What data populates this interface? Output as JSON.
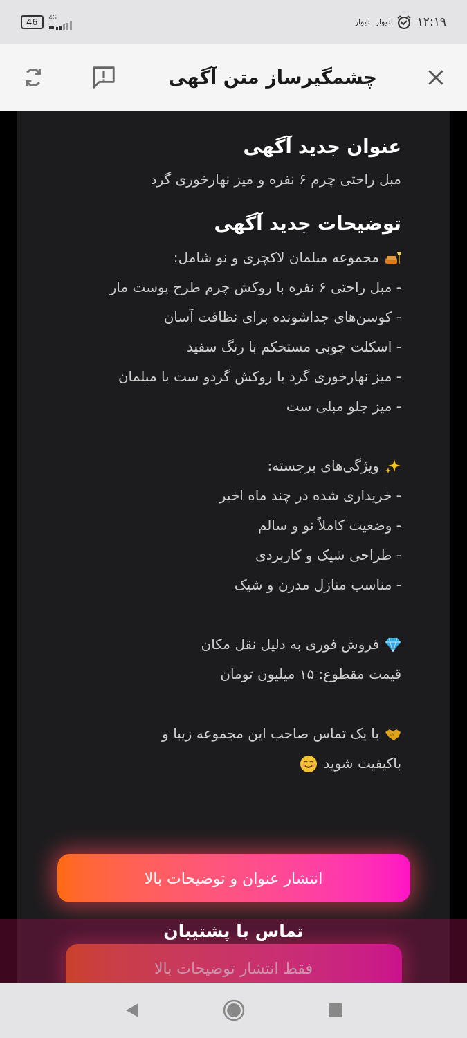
{
  "status_bar": {
    "time": "۱۲:۱۹",
    "notifications": [
      "دیوار",
      "دیوار"
    ],
    "battery": "46",
    "network": "4G"
  },
  "header": {
    "title": "چشمگیرساز متن آگهی"
  },
  "title_section": {
    "heading": "عنوان جدید آگهی",
    "text": "مبل راحتی چرم ۶ نفره و میز نهارخوری گرد"
  },
  "description_section": {
    "heading": "توضیحات جدید آگهی",
    "paragraphs": [
      {
        "lines": [
          "مجموعه مبلمان لاکچری و نو شامل:",
          "- مبل راحتی ۶ نفره با روکش چرم طرح پوست مار",
          "- کوسن‌های جداشونده برای نظافت آسان",
          "- اسکلت چوبی مستحکم با رنگ سفید",
          "- میز نهارخوری گرد با روکش گردو ست با مبلمان",
          "- میز جلو مبلی ست"
        ]
      },
      {
        "lines": [
          "ویژگی‌های برجسته:",
          "- خریداری شده در چند ماه اخیر",
          "- وضعیت کاملاً نو و سالم",
          "- طراحی شیک و کاربردی",
          "- مناسب منازل مدرن و شیک"
        ]
      },
      {
        "lines": [
          "فروش فوری به دلیل نقل مکان",
          "قیمت مقطوع: ۱۵ میلیون تومان"
        ]
      },
      {
        "lines": [
          "با یک تماس صاحب این مجموعه زیبا و",
          "باکیفیت شوید"
        ]
      }
    ]
  },
  "buttons": [
    "انتشار عنوان و توضیحات بالا",
    "فقط انتشار توضیحات بالا"
  ],
  "support_bar": {
    "label": "تماس با پشتیبان"
  }
}
